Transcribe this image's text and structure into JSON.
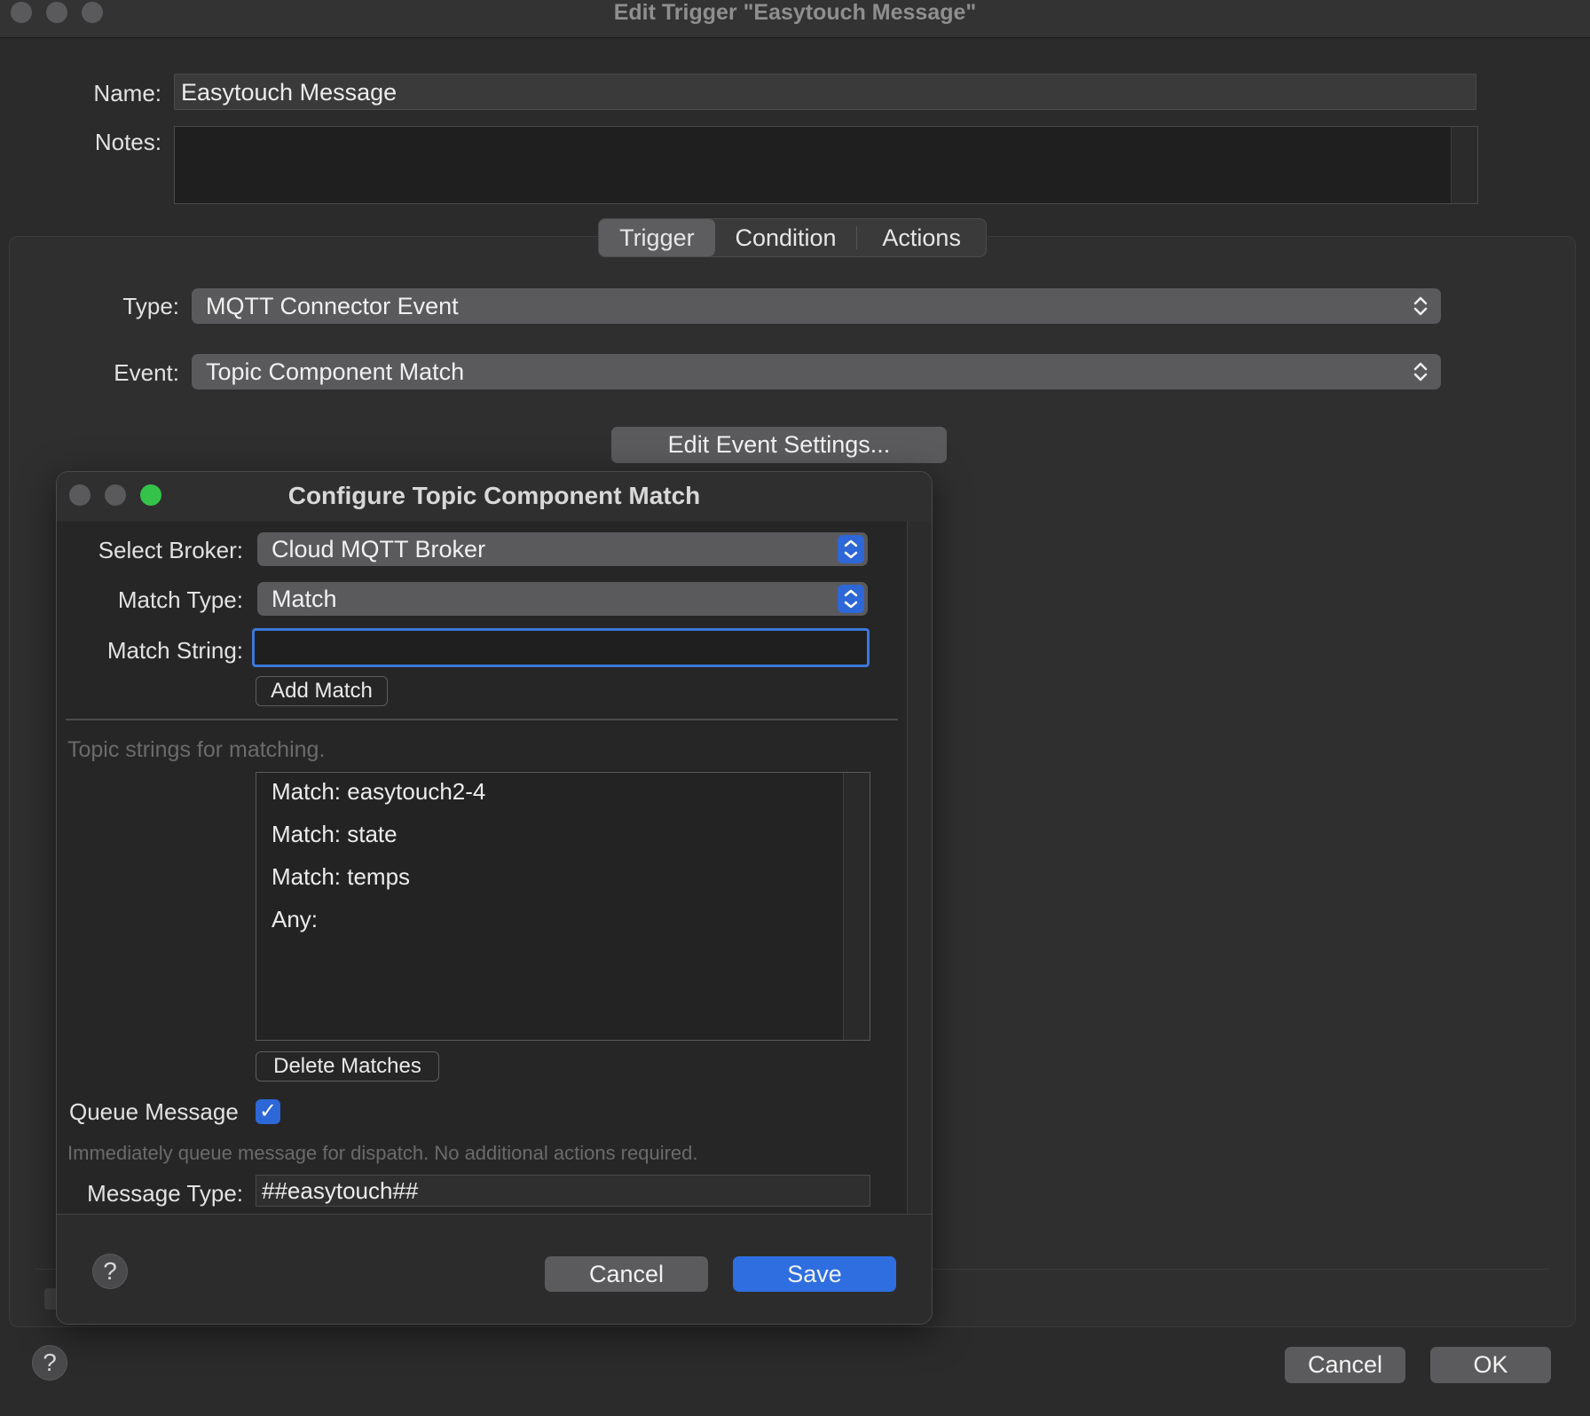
{
  "window": {
    "title": "Edit Trigger \"Easytouch Message\""
  },
  "form": {
    "name_label": "Name:",
    "name_value": "Easytouch Message",
    "notes_label": "Notes:",
    "notes_value": ""
  },
  "tabs": [
    {
      "label": "Trigger",
      "active": true
    },
    {
      "label": "Condition",
      "active": false
    },
    {
      "label": "Actions",
      "active": false
    }
  ],
  "trigger": {
    "type_label": "Type:",
    "type_value": "MQTT Connector Event",
    "event_label": "Event:",
    "event_value": "Topic Component Match",
    "edit_button": "Edit Event Settings..."
  },
  "footer": {
    "cancel": "Cancel",
    "ok": "OK",
    "help": "?"
  },
  "sheet": {
    "title": "Configure Topic Component Match",
    "broker_label": "Select Broker:",
    "broker_value": "Cloud MQTT Broker",
    "match_type_label": "Match Type:",
    "match_type_value": "Match",
    "match_string_label": "Match String:",
    "match_string_value": "",
    "add_match": "Add Match",
    "topics_hint": "Topic strings for matching.",
    "matches": [
      "Match: easytouch2-4",
      "Match: state",
      "Match: temps",
      "Any:"
    ],
    "delete_matches": "Delete Matches",
    "queue_label": "Queue Message",
    "queue_checked": true,
    "queue_hint": "Immediately queue message for dispatch.  No additional actions required.",
    "message_type_label": "Message Type:",
    "message_type_value": "##easytouch##",
    "help": "?",
    "cancel": "Cancel",
    "save": "Save"
  },
  "colors": {
    "accent": "#2e6ee0",
    "traffic_green": "#35c24a"
  }
}
